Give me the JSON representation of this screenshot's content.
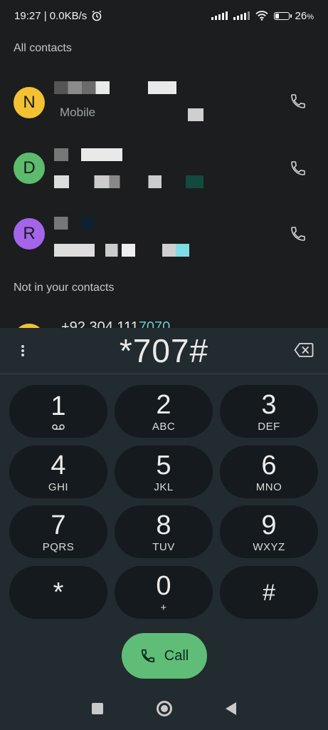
{
  "status_bar": {
    "time_speed": "19:27 | 0.0KB/s",
    "battery_percent": "26",
    "battery_suffix": "%"
  },
  "sections": {
    "all_contacts": "All contacts",
    "not_in_contacts": "Not in your contacts"
  },
  "contacts": [
    {
      "initial": "N",
      "color": "#f2c232",
      "subtext": "Mobile"
    },
    {
      "initial": "D",
      "color": "#5dbb6d",
      "subtext": ""
    },
    {
      "initial": "R",
      "color": "#a465e8",
      "subtext": ""
    }
  ],
  "unknown_number": "+92 304 111",
  "unknown_number_highlight": "7070",
  "dialer": {
    "number": "*707#",
    "keys": [
      {
        "digit": "1",
        "letters": ""
      },
      {
        "digit": "2",
        "letters": "ABC"
      },
      {
        "digit": "3",
        "letters": "DEF"
      },
      {
        "digit": "4",
        "letters": "GHI"
      },
      {
        "digit": "5",
        "letters": "JKL"
      },
      {
        "digit": "6",
        "letters": "MNO"
      },
      {
        "digit": "7",
        "letters": "PQRS"
      },
      {
        "digit": "8",
        "letters": "TUV"
      },
      {
        "digit": "9",
        "letters": "WXYZ"
      },
      {
        "digit": "*",
        "letters": ""
      },
      {
        "digit": "0",
        "letters": "+"
      },
      {
        "digit": "#",
        "letters": ""
      }
    ],
    "call_label": "Call"
  },
  "colors": {
    "call_green": "#5fbd78",
    "highlight_teal": "#66c8d6"
  }
}
